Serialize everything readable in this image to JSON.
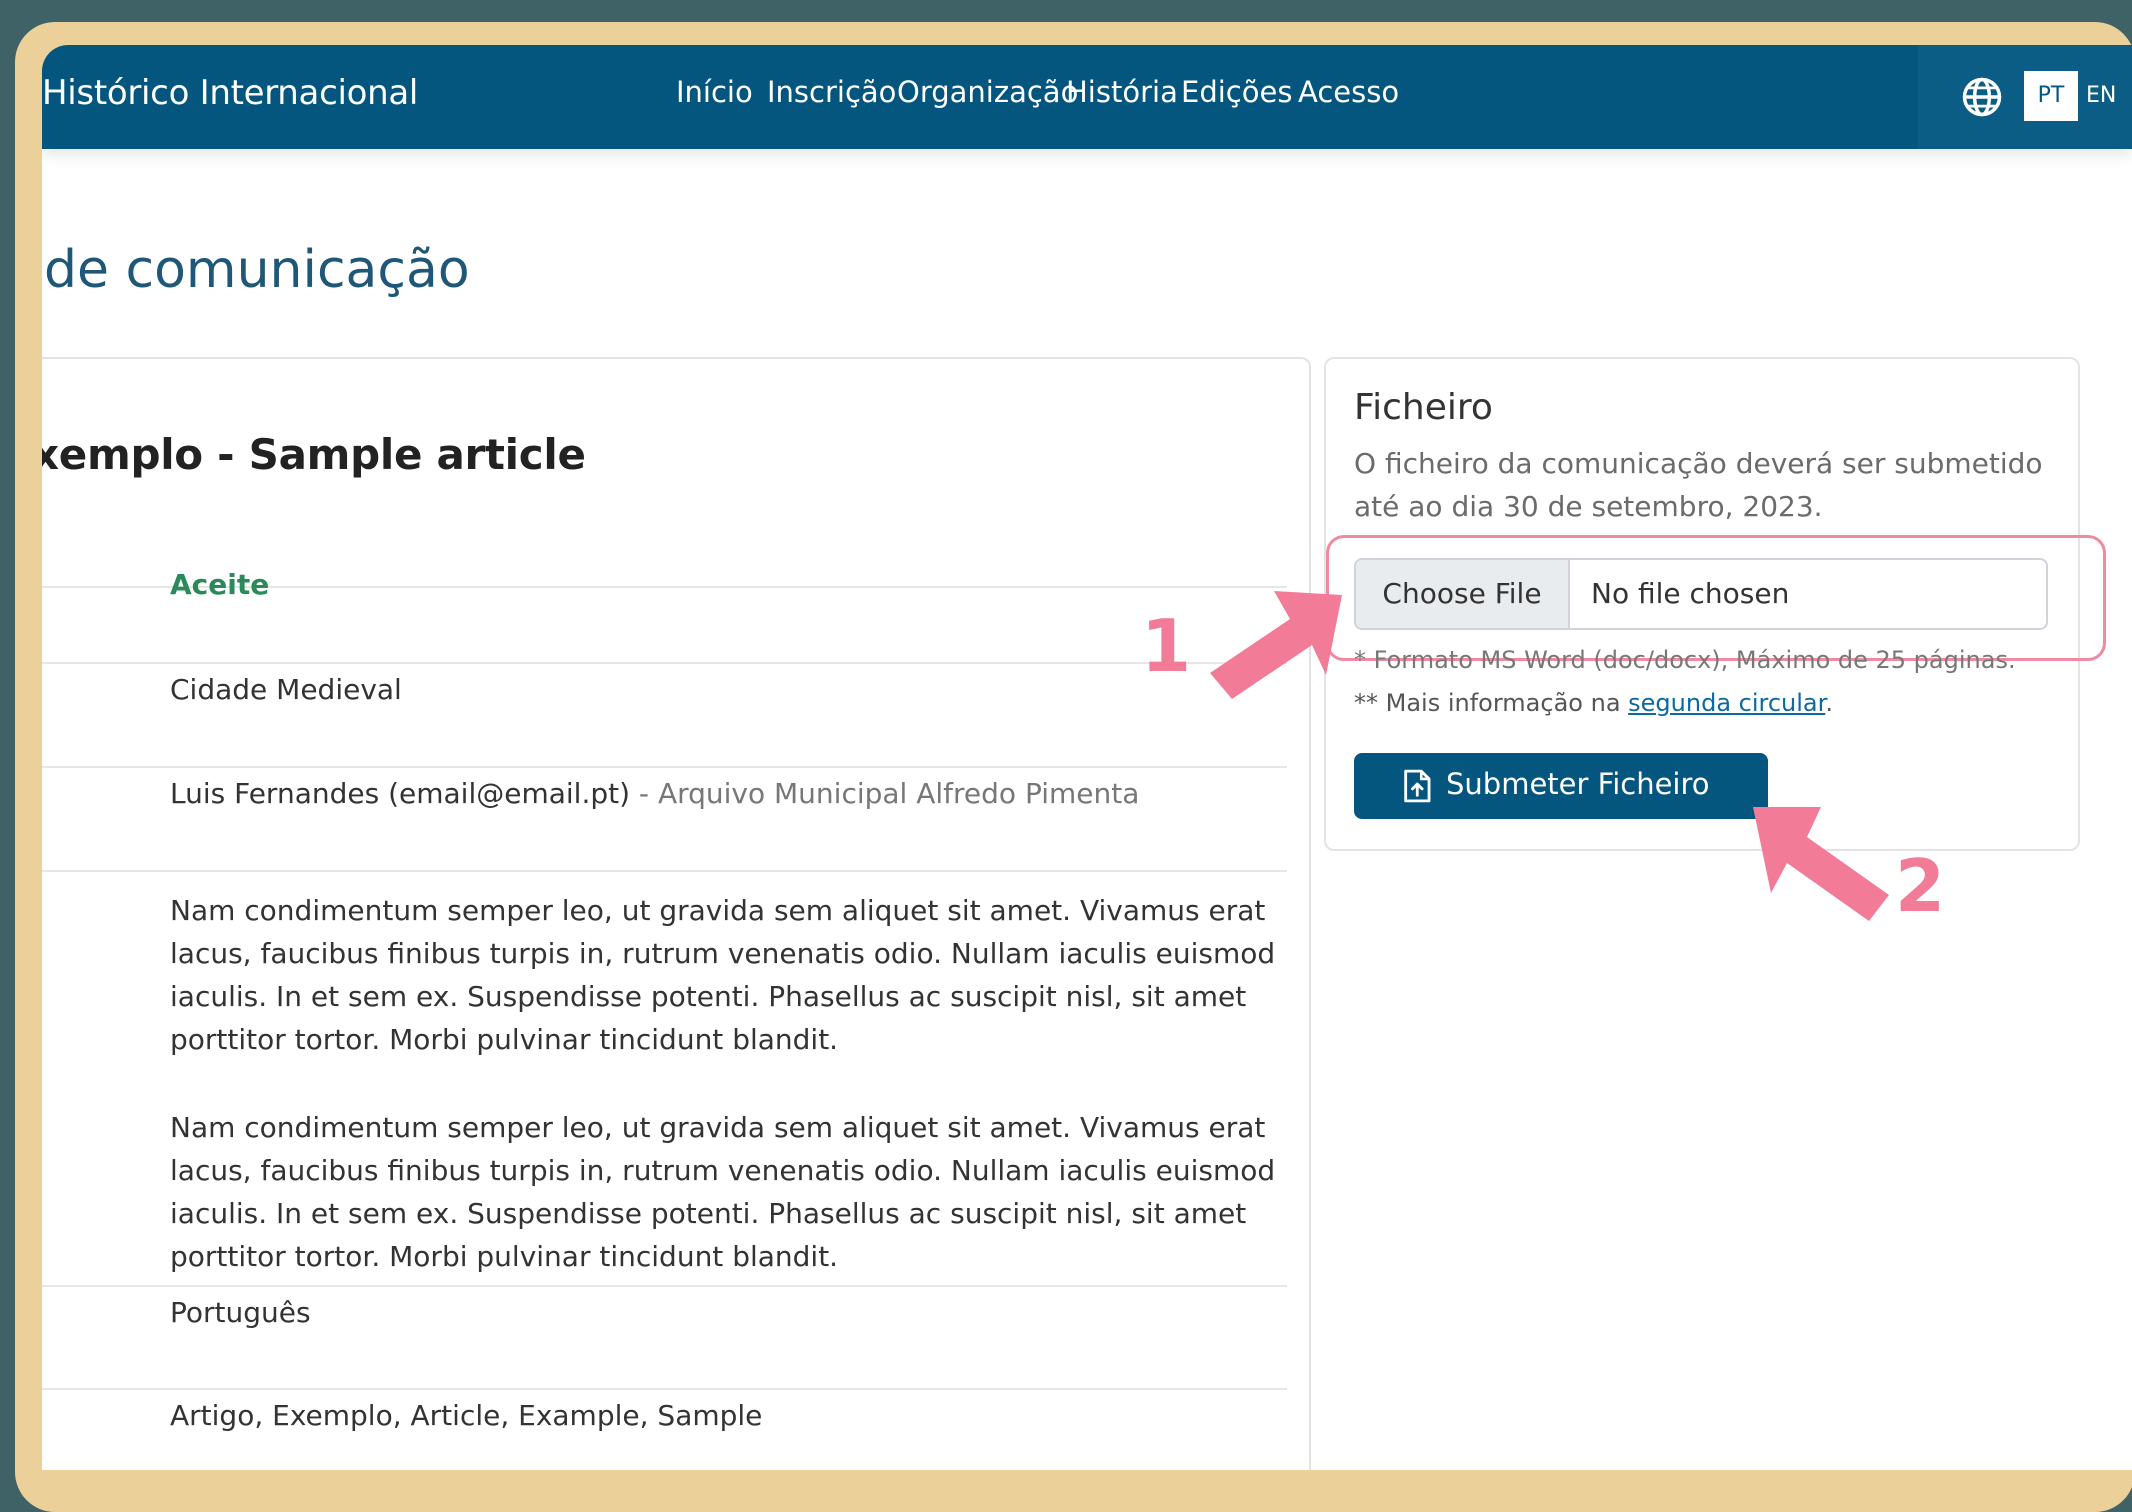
{
  "navbar": {
    "brand": "Histórico Internacional",
    "links": [
      "Início",
      "Inscrição",
      "Organização",
      "História",
      "Edições",
      "Acesso"
    ],
    "languages": [
      "PT",
      "EN"
    ],
    "active_language": "PT"
  },
  "page": {
    "title": "de comunicação"
  },
  "details": {
    "title": "xemplo - Sample article",
    "status": "Aceite",
    "theme": "Cidade Medieval",
    "author": "Luis Fernandes (email@email.pt)",
    "affiliation_separator": " - ",
    "affiliation": "Arquivo Municipal Alfredo Pimenta",
    "abstract_paragraphs": [
      "Nam condimentum semper leo, ut gravida sem aliquet sit amet. Vivamus erat lacus, faucibus finibus turpis in, rutrum venenatis odio. Nullam iaculis euismod iaculis. In et sem ex. Suspendisse potenti. Phasellus ac suscipit nisl, sit amet porttitor tortor. Morbi pulvinar tincidunt blandit.",
      "Nam condimentum semper leo, ut gravida sem aliquet sit amet. Vivamus erat lacus, faucibus finibus turpis in, rutrum venenatis odio. Nullam iaculis euismod iaculis. In et sem ex. Suspendisse potenti. Phasellus ac suscipit nisl, sit amet porttitor tortor. Morbi pulvinar tincidunt blandit."
    ],
    "language": "Português",
    "keywords": "Artigo, Exemplo, Article, Example, Sample"
  },
  "file_panel": {
    "title": "Ficheiro",
    "description": "O ficheiro da comunicação deverá ser submetido até ao dia 30 de setembro, 2023.",
    "choose_button": "Choose File",
    "file_status": "No file chosen",
    "note_format": "* Formato MS Word (doc/docx), Máximo de 25 páginas.",
    "note_info_prefix": "** Mais informação na ",
    "note_info_link": "segunda circular",
    "note_info_suffix": ".",
    "submit_label": "Submeter Ficheiro"
  },
  "annotations": {
    "step1": "1",
    "step2": "2",
    "color": "#f27c97"
  },
  "colors": {
    "navbar": "#04567e",
    "accent_green": "#2b8a5a",
    "frame": "#ecd09a",
    "backdrop": "#3e6266"
  }
}
